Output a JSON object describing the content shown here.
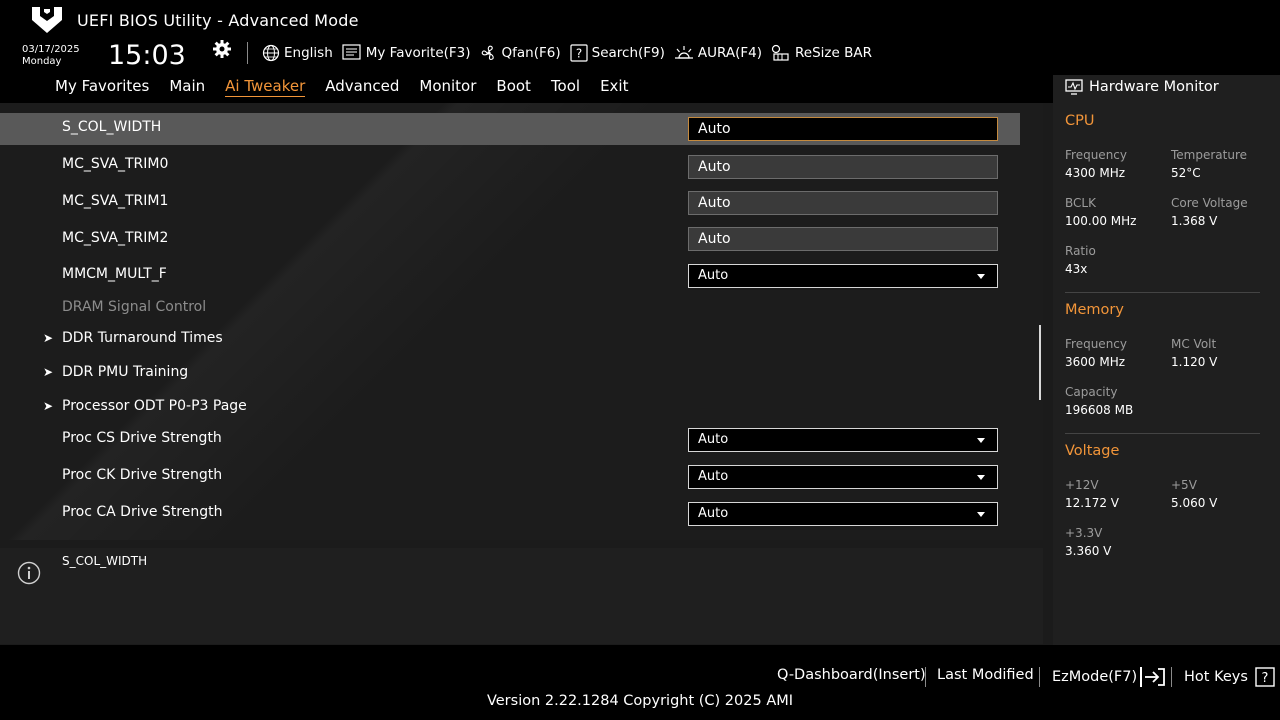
{
  "header": {
    "title": "UEFI BIOS Utility - Advanced Mode",
    "date": "03/17/2025",
    "day": "Monday",
    "time": "15:03",
    "toolbar": {
      "language": "English",
      "favorite": "My Favorite(F3)",
      "qfan": "Qfan(F6)",
      "search": "Search(F9)",
      "aura": "AURA(F4)",
      "resize_bar": "ReSize BAR"
    }
  },
  "tabs": [
    "My Favorites",
    "Main",
    "Ai Tweaker",
    "Advanced",
    "Monitor",
    "Boot",
    "Tool",
    "Exit"
  ],
  "active_tab": "Ai Tweaker",
  "settings": [
    {
      "label": "S_COL_WIDTH",
      "value": "Auto",
      "kind": "text",
      "selected": true
    },
    {
      "label": "MC_SVA_TRIM0",
      "value": "Auto",
      "kind": "text"
    },
    {
      "label": "MC_SVA_TRIM1",
      "value": "Auto",
      "kind": "text"
    },
    {
      "label": "MC_SVA_TRIM2",
      "value": "Auto",
      "kind": "text"
    },
    {
      "label": "MMCM_MULT_F",
      "value": "Auto",
      "kind": "dropdown"
    },
    {
      "label": "DRAM Signal Control",
      "kind": "header"
    },
    {
      "label": "DDR Turnaround Times",
      "kind": "submenu"
    },
    {
      "label": "DDR PMU Training",
      "kind": "submenu"
    },
    {
      "label": "Processor ODT P0-P3 Page",
      "kind": "submenu"
    },
    {
      "label": "Proc CS Drive Strength",
      "value": "Auto",
      "kind": "dropdown"
    },
    {
      "label": "Proc CK Drive Strength",
      "value": "Auto",
      "kind": "dropdown"
    },
    {
      "label": "Proc CA Drive Strength",
      "value": "Auto",
      "kind": "dropdown"
    }
  ],
  "help": {
    "text": "S_COL_WIDTH"
  },
  "hardware_monitor": {
    "title": "Hardware Monitor",
    "cpu": {
      "heading": "CPU",
      "frequency_label": "Frequency",
      "frequency": "4300 MHz",
      "temperature_label": "Temperature",
      "temperature": "52°C",
      "bclk_label": "BCLK",
      "bclk": "100.00 MHz",
      "core_voltage_label": "Core Voltage",
      "core_voltage": "1.368 V",
      "ratio_label": "Ratio",
      "ratio": "43x"
    },
    "memory": {
      "heading": "Memory",
      "frequency_label": "Frequency",
      "frequency": "3600 MHz",
      "mc_volt_label": "MC Volt",
      "mc_volt": "1.120 V",
      "capacity_label": "Capacity",
      "capacity": "196608 MB"
    },
    "voltage": {
      "heading": "Voltage",
      "v12_label": "+12V",
      "v12": "12.172 V",
      "v5_label": "+5V",
      "v5": "5.060 V",
      "v33_label": "+3.3V",
      "v33": "3.360 V"
    }
  },
  "footer": {
    "q_dashboard": "Q-Dashboard(Insert)",
    "last_modified": "Last Modified",
    "ezmode": "EzMode(F7)",
    "hot_keys": "Hot Keys",
    "version": "Version 2.22.1284 Copyright (C) 2025 AMI"
  },
  "colors": {
    "accent": "#f29539",
    "selected_row": "#595959",
    "selected_border": "#c58a3e"
  }
}
